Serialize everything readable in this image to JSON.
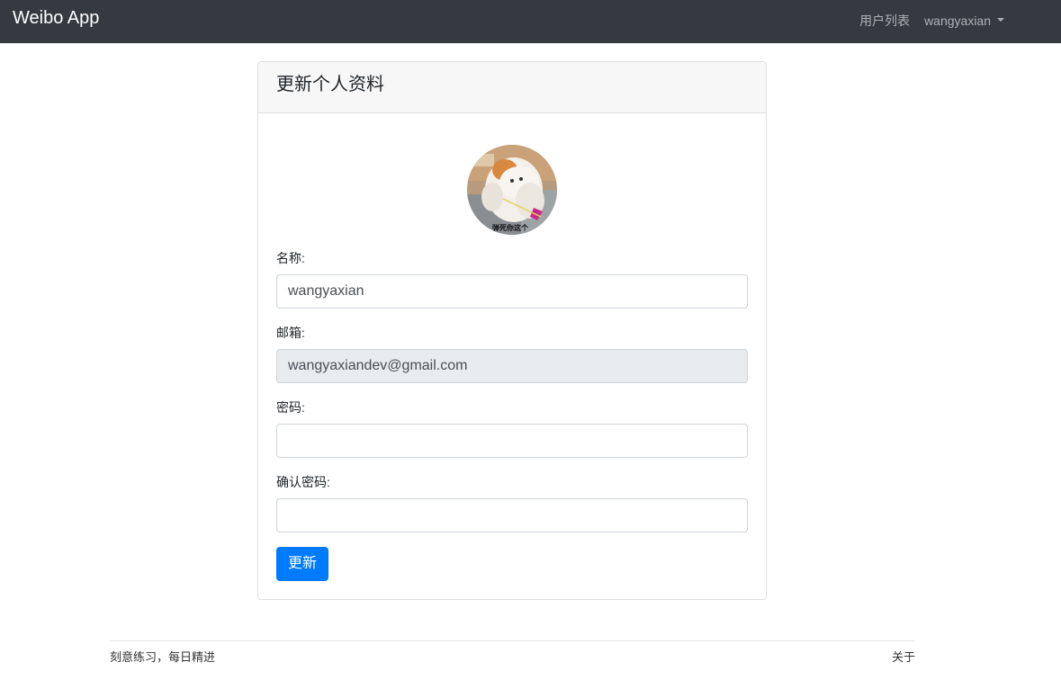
{
  "navbar": {
    "brand": "Weibo App",
    "links": [
      {
        "label": "用户列表"
      },
      {
        "label": "wangyaxian"
      }
    ]
  },
  "card": {
    "title": "更新个人资料",
    "avatar_caption": "弹死你这个"
  },
  "form": {
    "name_label": "名称:",
    "name_value": "wangyaxian",
    "email_label": "邮箱:",
    "email_value": "wangyaxiandev@gmail.com",
    "password_label": "密码:",
    "password_value": "",
    "confirm_label": "确认密码:",
    "confirm_value": "",
    "submit_label": "更新"
  },
  "footer": {
    "slogan": "刻意练习，每日精进",
    "about": "关于"
  },
  "colors": {
    "navbar_bg": "#343a40",
    "primary": "#007bff",
    "readonly_bg": "#e9ecef"
  }
}
